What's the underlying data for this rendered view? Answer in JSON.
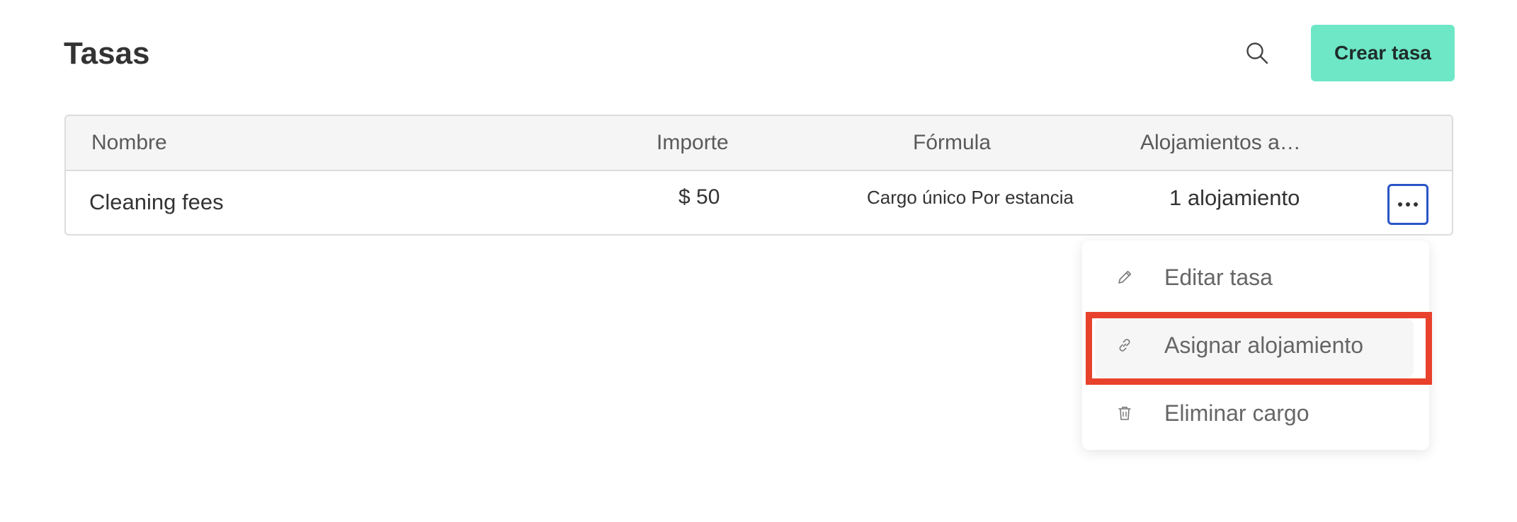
{
  "header": {
    "title": "Tasas",
    "search_icon": "search-icon",
    "create_label": "Crear tasa"
  },
  "table": {
    "columns": [
      "Nombre",
      "Importe",
      "Fórmula",
      "Alojamientos a…"
    ],
    "rows": [
      {
        "nombre": "Cleaning fees",
        "importe": "$ 50",
        "formula": "Cargo único Por estancia",
        "alojamientos": "1 alojamiento",
        "actions_icon": "more-horizontal-icon"
      }
    ]
  },
  "menu": {
    "items": [
      {
        "label": "Editar tasa",
        "icon": "pencil-icon"
      },
      {
        "label": "Asignar alojamiento",
        "icon": "link-icon"
      },
      {
        "label": "Eliminar cargo",
        "icon": "trash-icon"
      }
    ]
  },
  "colors": {
    "accent": "#6ee7c7",
    "focus_border": "#2a55c6",
    "highlight": "#e8412c"
  }
}
